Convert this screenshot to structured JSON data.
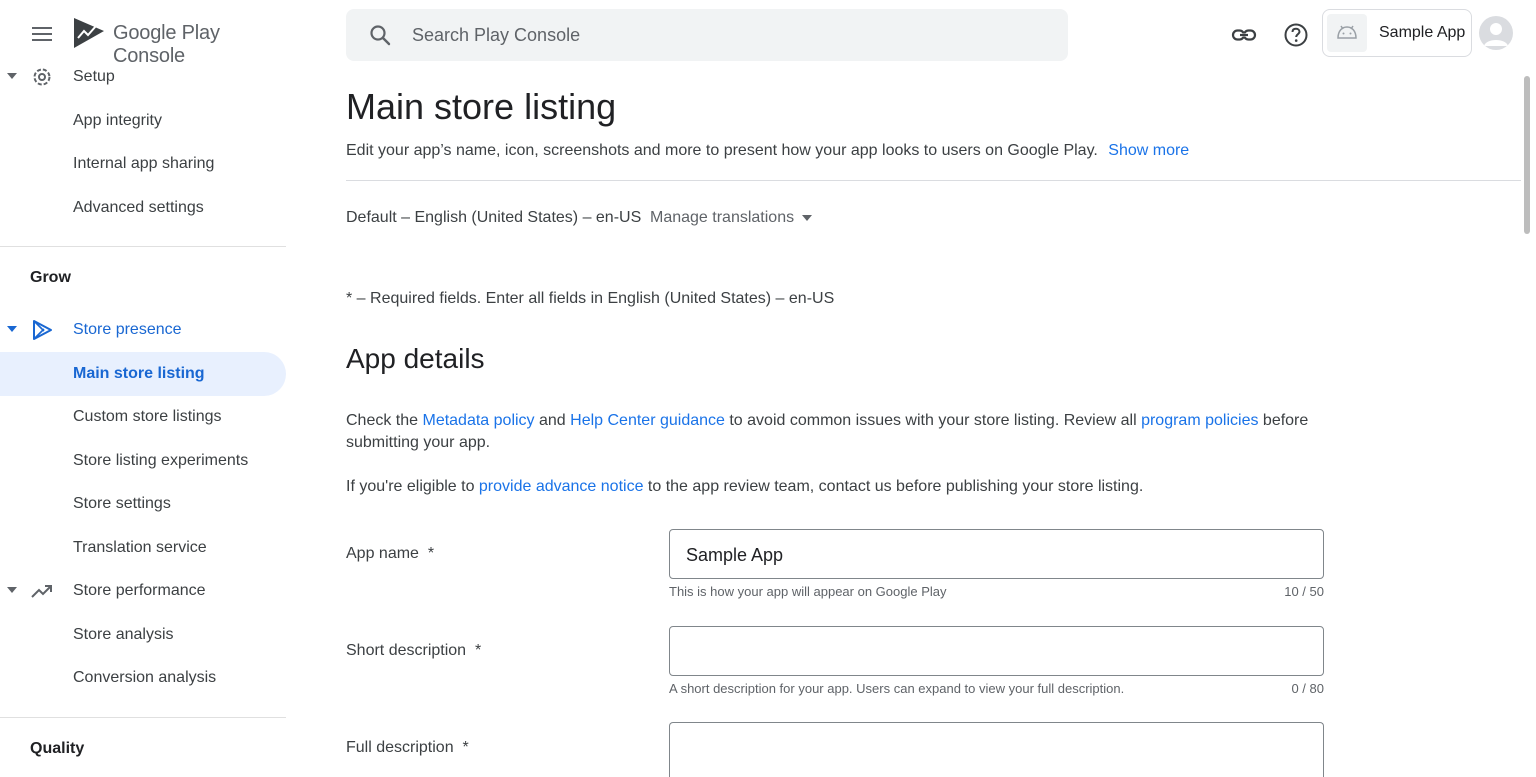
{
  "brand": {
    "name": "Google Play",
    "suffix": "Console"
  },
  "search": {
    "placeholder": "Search Play Console"
  },
  "app_chip": {
    "name": "Sample App"
  },
  "sidebar": {
    "setup": {
      "label": "Setup",
      "items": [
        "App integrity",
        "Internal app sharing",
        "Advanced settings"
      ]
    },
    "grow_title": "Grow",
    "store_presence": {
      "label": "Store presence",
      "items": [
        "Main store listing",
        "Custom store listings",
        "Store listing experiments",
        "Store settings",
        "Translation service"
      ]
    },
    "store_performance": {
      "label": "Store performance",
      "items": [
        "Store analysis",
        "Conversion analysis"
      ]
    },
    "quality_title": "Quality"
  },
  "page": {
    "title": "Main store listing",
    "subtitle": "Edit your app’s name, icon, screenshots and more to present how your app looks to users on Google Play.",
    "show_more": "Show more",
    "default_language": "Default – English (United States) – en-US",
    "manage_translations": "Manage translations",
    "required_note": "* – Required fields. Enter all fields in English (United States) – en-US"
  },
  "app_details": {
    "heading": "App details",
    "para1": {
      "t1": "Check the ",
      "link1": "Metadata policy",
      "t2": " and ",
      "link2": "Help Center guidance",
      "t3": " to avoid common issues with your store listing. Review all ",
      "link3": "program policies",
      "t4": " before submitting your app."
    },
    "para2": {
      "t1": "If you're eligible to ",
      "link1": "provide advance notice",
      "t2": " to the app review team, contact us before publishing your store listing."
    },
    "fields": {
      "app_name": {
        "label": "App name  *",
        "value": "Sample App",
        "helper": "This is how your app will appear on Google Play",
        "count": "10 / 50"
      },
      "short_description": {
        "label": "Short description  *",
        "value": "",
        "helper": "A short description for your app. Users can expand to view your full description.",
        "count": "0 / 80"
      },
      "full_description": {
        "label": "Full description  *",
        "value": ""
      }
    }
  },
  "colors": {
    "accent": "#1a73e8",
    "active_bg": "#e8f0fe",
    "active_text": "#1967d2"
  }
}
